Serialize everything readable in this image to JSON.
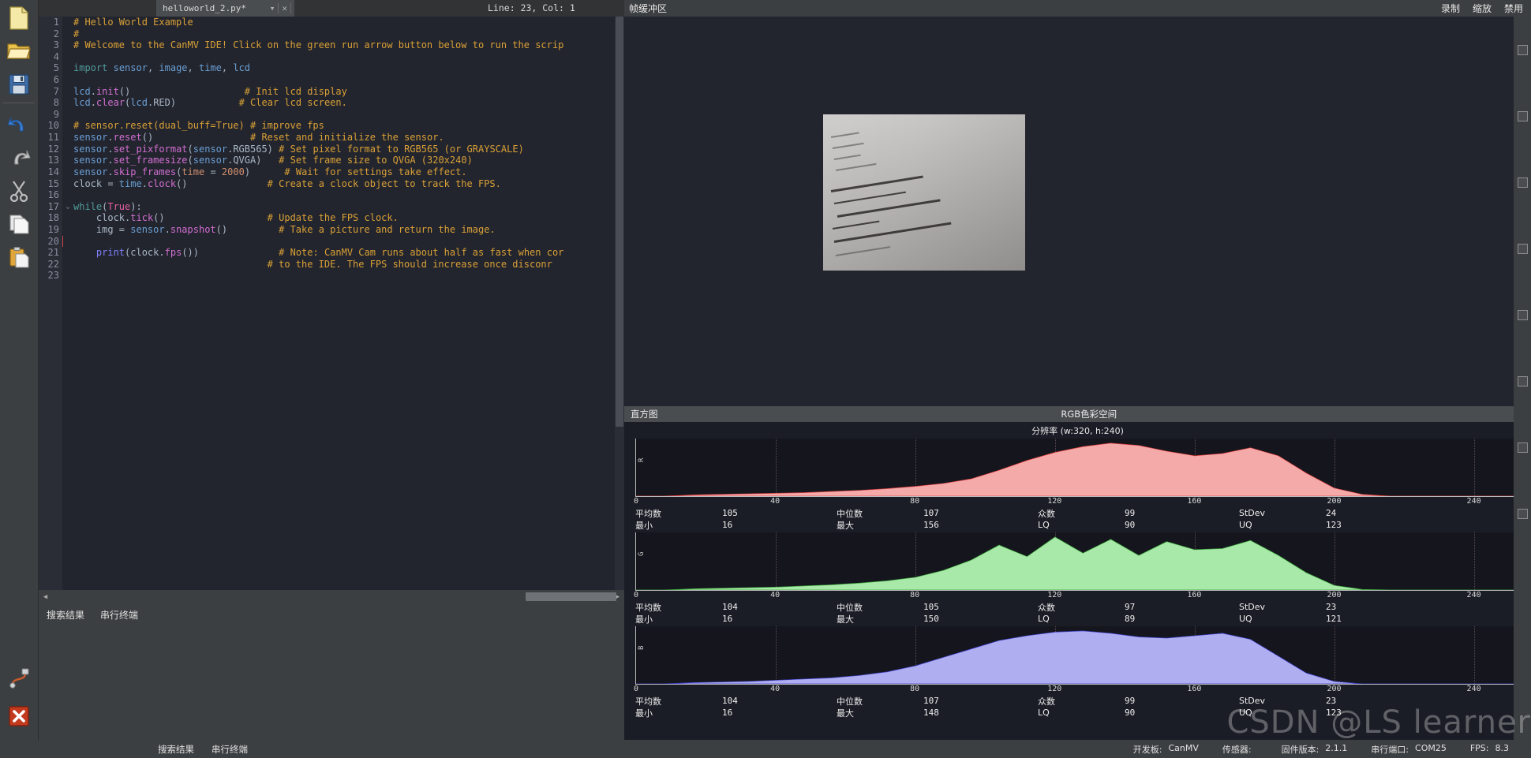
{
  "window": {
    "file_tab": "helloworld_2.py*",
    "tab_dropdown_icon": "chevron-down-icon",
    "tab_close_icon": "close-icon",
    "line_col": "Line: 23, Col: 1",
    "framebuffer_title": "帧缓冲区",
    "framebuffer_actions": [
      "录制",
      "缩放",
      "禁用"
    ]
  },
  "toolbar": {
    "items": [
      {
        "name": "new-file-icon",
        "label": "新建"
      },
      {
        "name": "open-folder-icon",
        "label": "打开"
      },
      {
        "name": "save-icon",
        "label": "保存"
      },
      {
        "name": "undo-icon",
        "label": "撤销"
      },
      {
        "name": "redo-icon",
        "label": "重做"
      },
      {
        "name": "cut-icon",
        "label": "剪切"
      },
      {
        "name": "copy-icon",
        "label": "复制"
      },
      {
        "name": "paste-icon",
        "label": "粘贴"
      }
    ],
    "bottom_items": [
      {
        "name": "connect-usb-icon",
        "label": "连接"
      },
      {
        "name": "stop-script-icon",
        "label": "停止"
      }
    ]
  },
  "editor": {
    "total_lines": 23,
    "cursor_line": 20,
    "lines": [
      {
        "n": 1,
        "tokens": [
          {
            "t": "# Hello World Example",
            "c": "k-com"
          }
        ]
      },
      {
        "n": 2,
        "tokens": [
          {
            "t": "#",
            "c": "k-com"
          }
        ]
      },
      {
        "n": 3,
        "tokens": [
          {
            "t": "# Welcome to the CanMV IDE! Click on the green run arrow button below to run the scrip",
            "c": "k-com"
          }
        ]
      },
      {
        "n": 4,
        "tokens": []
      },
      {
        "n": 5,
        "tokens": [
          {
            "t": "import",
            "c": "k-py"
          },
          {
            "t": " ",
            "c": "k-id"
          },
          {
            "t": "sensor",
            "c": "k-mod"
          },
          {
            "t": ", ",
            "c": "k-id"
          },
          {
            "t": "image",
            "c": "k-mod"
          },
          {
            "t": ", ",
            "c": "k-id"
          },
          {
            "t": "time",
            "c": "k-mod"
          },
          {
            "t": ", ",
            "c": "k-id"
          },
          {
            "t": "lcd",
            "c": "k-mod"
          }
        ]
      },
      {
        "n": 6,
        "tokens": []
      },
      {
        "n": 7,
        "tokens": [
          {
            "t": "lcd",
            "c": "k-mod"
          },
          {
            "t": ".",
            "c": "k-id"
          },
          {
            "t": "init",
            "c": "k-fn"
          },
          {
            "t": "()",
            "c": "k-id"
          },
          {
            "t": "                    ",
            "c": "k-id"
          },
          {
            "t": "# Init lcd display",
            "c": "k-com"
          }
        ]
      },
      {
        "n": 8,
        "tokens": [
          {
            "t": "lcd",
            "c": "k-mod"
          },
          {
            "t": ".",
            "c": "k-id"
          },
          {
            "t": "clear",
            "c": "k-fn"
          },
          {
            "t": "(",
            "c": "k-id"
          },
          {
            "t": "lcd",
            "c": "k-mod"
          },
          {
            "t": ".RED)",
            "c": "k-id"
          },
          {
            "t": "           ",
            "c": "k-id"
          },
          {
            "t": "# Clear lcd screen.",
            "c": "k-com"
          }
        ]
      },
      {
        "n": 9,
        "tokens": []
      },
      {
        "n": 10,
        "tokens": [
          {
            "t": "# sensor.reset(dual_buff=True) # improve fps",
            "c": "k-com"
          }
        ]
      },
      {
        "n": 11,
        "tokens": [
          {
            "t": "sensor",
            "c": "k-mod"
          },
          {
            "t": ".",
            "c": "k-id"
          },
          {
            "t": "reset",
            "c": "k-fn"
          },
          {
            "t": "()",
            "c": "k-id"
          },
          {
            "t": "                 ",
            "c": "k-id"
          },
          {
            "t": "# Reset and initialize the sensor.",
            "c": "k-com"
          }
        ]
      },
      {
        "n": 12,
        "tokens": [
          {
            "t": "sensor",
            "c": "k-mod"
          },
          {
            "t": ".",
            "c": "k-id"
          },
          {
            "t": "set_pixformat",
            "c": "k-fn"
          },
          {
            "t": "(",
            "c": "k-id"
          },
          {
            "t": "sensor",
            "c": "k-mod"
          },
          {
            "t": ".RGB565)",
            "c": "k-id"
          },
          {
            "t": " ",
            "c": "k-id"
          },
          {
            "t": "# Set pixel format to RGB565 (or GRAYSCALE)",
            "c": "k-com"
          }
        ]
      },
      {
        "n": 13,
        "tokens": [
          {
            "t": "sensor",
            "c": "k-mod"
          },
          {
            "t": ".",
            "c": "k-id"
          },
          {
            "t": "set_framesize",
            "c": "k-fn"
          },
          {
            "t": "(",
            "c": "k-id"
          },
          {
            "t": "sensor",
            "c": "k-mod"
          },
          {
            "t": ".QVGA)",
            "c": "k-id"
          },
          {
            "t": "   ",
            "c": "k-id"
          },
          {
            "t": "# Set frame size to QVGA (320x240)",
            "c": "k-com"
          }
        ]
      },
      {
        "n": 14,
        "tokens": [
          {
            "t": "sensor",
            "c": "k-mod"
          },
          {
            "t": ".",
            "c": "k-id"
          },
          {
            "t": "skip_frames",
            "c": "k-fn"
          },
          {
            "t": "(",
            "c": "k-id"
          },
          {
            "t": "time",
            "c": "k-num"
          },
          {
            "t": " = ",
            "c": "k-id"
          },
          {
            "t": "2000",
            "c": "k-num"
          },
          {
            "t": ")",
            "c": "k-id"
          },
          {
            "t": "      ",
            "c": "k-id"
          },
          {
            "t": "# Wait for settings take effect.",
            "c": "k-com"
          }
        ]
      },
      {
        "n": 15,
        "tokens": [
          {
            "t": "clock = ",
            "c": "k-id"
          },
          {
            "t": "time",
            "c": "k-mod"
          },
          {
            "t": ".",
            "c": "k-id"
          },
          {
            "t": "clock",
            "c": "k-fn"
          },
          {
            "t": "()",
            "c": "k-id"
          },
          {
            "t": "              ",
            "c": "k-id"
          },
          {
            "t": "# Create a clock object to track the FPS.",
            "c": "k-com"
          }
        ]
      },
      {
        "n": 16,
        "tokens": []
      },
      {
        "n": 17,
        "tokens": [
          {
            "t": "while",
            "c": "k-py"
          },
          {
            "t": "(",
            "c": "k-id"
          },
          {
            "t": "True",
            "c": "k-cls"
          },
          {
            "t": "):",
            "c": "k-id"
          }
        ]
      },
      {
        "n": 18,
        "tokens": [
          {
            "t": "    clock",
            "c": "k-id"
          },
          {
            "t": ".",
            "c": "k-id"
          },
          {
            "t": "tick",
            "c": "k-fn"
          },
          {
            "t": "()",
            "c": "k-id"
          },
          {
            "t": "                  ",
            "c": "k-id"
          },
          {
            "t": "# Update the FPS clock.",
            "c": "k-com"
          }
        ]
      },
      {
        "n": 19,
        "tokens": [
          {
            "t": "    img = ",
            "c": "k-id"
          },
          {
            "t": "sensor",
            "c": "k-mod"
          },
          {
            "t": ".",
            "c": "k-id"
          },
          {
            "t": "snapshot",
            "c": "k-fn"
          },
          {
            "t": "()",
            "c": "k-id"
          },
          {
            "t": "         ",
            "c": "k-id"
          },
          {
            "t": "# Take a picture and return the image.",
            "c": "k-com"
          }
        ]
      },
      {
        "n": 20,
        "tokens": []
      },
      {
        "n": 21,
        "tokens": [
          {
            "t": "    ",
            "c": "k-id"
          },
          {
            "t": "print",
            "c": "k-bi"
          },
          {
            "t": "(clock",
            "c": "k-id"
          },
          {
            "t": ".",
            "c": "k-id"
          },
          {
            "t": "fps",
            "c": "k-fn"
          },
          {
            "t": "())",
            "c": "k-id"
          },
          {
            "t": "              ",
            "c": "k-id"
          },
          {
            "t": "# Note: CanMV Cam runs about half as fast when cor",
            "c": "k-com"
          }
        ]
      },
      {
        "n": 22,
        "tokens": [
          {
            "t": "                                  ",
            "c": "k-id"
          },
          {
            "t": "# to the IDE. The FPS should increase once disconr",
            "c": "k-com"
          }
        ]
      },
      {
        "n": 23,
        "tokens": []
      }
    ]
  },
  "bottom_tabs": {
    "items": [
      "搜索结果",
      "串行终端"
    ]
  },
  "histogram": {
    "panel_title": "直方图",
    "colorspace": "RGB色彩空间",
    "caret_icon": "chevron-down-icon",
    "resolution": "分辨率 (w:320, h:240)",
    "stat_labels": {
      "mean": "平均数",
      "median": "中位数",
      "mode": "众数",
      "stdev": "StDev",
      "min": "最小",
      "max": "最大",
      "lq": "LQ",
      "uq": "UQ"
    }
  },
  "chart_data": [
    {
      "type": "area",
      "name": "R",
      "channel_label": "R",
      "color": "#f5aaaa",
      "stroke": "#e04040",
      "title": "分辨率 (w:320, h:240)",
      "xlabel": "",
      "ylabel": "R",
      "xlim": [
        0,
        255
      ],
      "xticks": [
        0,
        40,
        80,
        120,
        160,
        200,
        240
      ],
      "grid": true,
      "x": [
        0,
        8,
        16,
        24,
        32,
        40,
        48,
        56,
        64,
        72,
        80,
        88,
        96,
        104,
        112,
        120,
        128,
        136,
        144,
        152,
        160,
        168,
        176,
        184,
        192,
        200,
        208,
        216,
        224,
        232,
        240,
        248,
        255
      ],
      "values": [
        0,
        0,
        2,
        3,
        4,
        5,
        6,
        8,
        10,
        13,
        17,
        22,
        30,
        45,
        62,
        76,
        86,
        92,
        88,
        78,
        70,
        74,
        84,
        70,
        40,
        14,
        3,
        0,
        0,
        0,
        0,
        0,
        0
      ],
      "stats": {
        "mean": 105,
        "median": 107,
        "mode": 99,
        "stdev": 24,
        "min": 16,
        "max": 156,
        "lq": 90,
        "uq": 123
      }
    },
    {
      "type": "area",
      "name": "G",
      "channel_label": "G",
      "color": "#a8e8a8",
      "stroke": "#3aa83a",
      "xlabel": "",
      "ylabel": "G",
      "xlim": [
        0,
        255
      ],
      "xticks": [
        0,
        40,
        80,
        120,
        160,
        200,
        240
      ],
      "grid": true,
      "x": [
        0,
        8,
        16,
        24,
        32,
        40,
        48,
        56,
        64,
        72,
        80,
        88,
        96,
        104,
        112,
        120,
        128,
        136,
        144,
        152,
        160,
        168,
        176,
        184,
        192,
        200,
        208,
        216,
        224,
        232,
        240,
        248,
        255
      ],
      "values": [
        0,
        0,
        2,
        3,
        4,
        5,
        7,
        9,
        12,
        16,
        22,
        34,
        52,
        78,
        58,
        92,
        64,
        88,
        60,
        84,
        70,
        72,
        86,
        60,
        30,
        8,
        1,
        0,
        0,
        0,
        0,
        0,
        0
      ],
      "stats": {
        "mean": 104,
        "median": 105,
        "mode": 97,
        "stdev": 23,
        "min": 16,
        "max": 150,
        "lq": 89,
        "uq": 121
      }
    },
    {
      "type": "area",
      "name": "B",
      "channel_label": "B",
      "color": "#aeaef0",
      "stroke": "#4040d0",
      "xlabel": "",
      "ylabel": "B",
      "xlim": [
        0,
        255
      ],
      "xticks": [
        0,
        40,
        80,
        120,
        160,
        200,
        240
      ],
      "grid": true,
      "x": [
        0,
        8,
        16,
        24,
        32,
        40,
        48,
        56,
        64,
        72,
        80,
        88,
        96,
        104,
        112,
        120,
        128,
        136,
        144,
        152,
        160,
        168,
        176,
        184,
        192,
        200,
        208,
        216,
        224,
        232,
        240,
        248,
        255
      ],
      "values": [
        0,
        0,
        2,
        3,
        4,
        6,
        8,
        10,
        14,
        20,
        30,
        44,
        58,
        72,
        80,
        86,
        88,
        84,
        78,
        76,
        80,
        84,
        74,
        46,
        18,
        4,
        0,
        0,
        0,
        0,
        0,
        0,
        0
      ],
      "stats": {
        "mean": 104,
        "median": 107,
        "mode": 99,
        "stdev": 23,
        "min": 16,
        "max": 148,
        "lq": 90,
        "uq": 123
      }
    }
  ],
  "statusbar": {
    "board_label": "开发板:",
    "board_value": "CanMV",
    "sensor_label": "传感器:",
    "sensor_value": "",
    "firmware_label": "固件版本:",
    "firmware_value": "2.1.1",
    "port_label": "串行端口:",
    "port_value": "COM25",
    "fps_label": "FPS:",
    "fps_value": "8.3"
  },
  "watermark": "CSDN @LS learner"
}
